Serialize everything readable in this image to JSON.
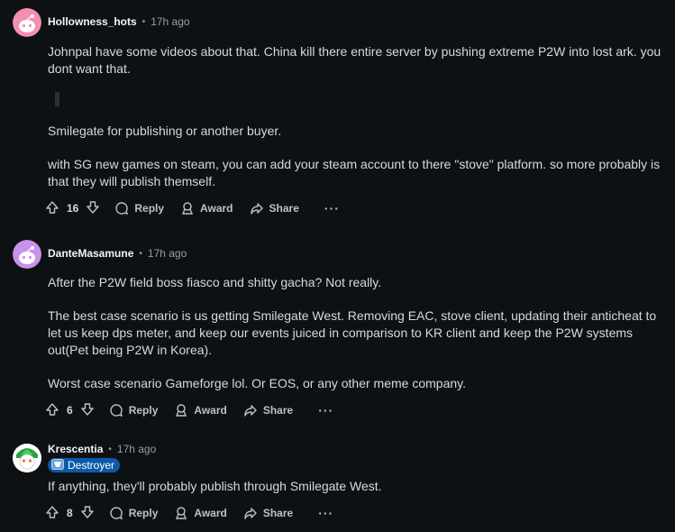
{
  "comments": [
    {
      "author": "Hollowness_hots",
      "separator": "•",
      "time": "17h ago",
      "paragraphs": [
        "Johnpal have some videos about that. China kill there entire server by pushing extreme P2W into lost ark. you dont want that.",
        "Smilegate for publishing or another buyer.",
        "with SG new games on steam, you can add your steam account to there \"stove\" platform. so more probably is that they will publish themself."
      ],
      "votes": "16",
      "reply_label": "Reply",
      "award_label": "Award",
      "share_label": "Share",
      "more_label": "···",
      "avatar_color": "#f48fb1"
    },
    {
      "author": "DanteMasamune",
      "separator": "•",
      "time": "17h ago",
      "paragraphs": [
        "After the P2W field boss fiasco and shitty gacha? Not really.",
        "The best case scenario is us getting Smilegate West. Removing EAC, stove client, updating their anticheat to let us keep dps meter, and keep our events juiced in comparison to KR client and keep the P2W systems out(Pet being P2W in Korea).",
        "Worst case scenario Gameforge lol. Or EOS, or any other meme company."
      ],
      "votes": "6",
      "reply_label": "Reply",
      "award_label": "Award",
      "share_label": "Share",
      "more_label": "···",
      "avatar_color": "#c792ea"
    },
    {
      "author": "Krescentia",
      "separator": "•",
      "time": "17h ago",
      "flair": "Destroyer",
      "paragraphs": [
        "If anything, they'll probably publish through Smilegate West."
      ],
      "votes": "8",
      "reply_label": "Reply",
      "award_label": "Award",
      "share_label": "Share",
      "more_label": "···",
      "avatar_color": "#46d160"
    }
  ],
  "colors": {
    "background": "#0e1113",
    "text": "#d7dadc",
    "meta": "#8ba2ad",
    "flair_bg": "#0b5aa8"
  }
}
